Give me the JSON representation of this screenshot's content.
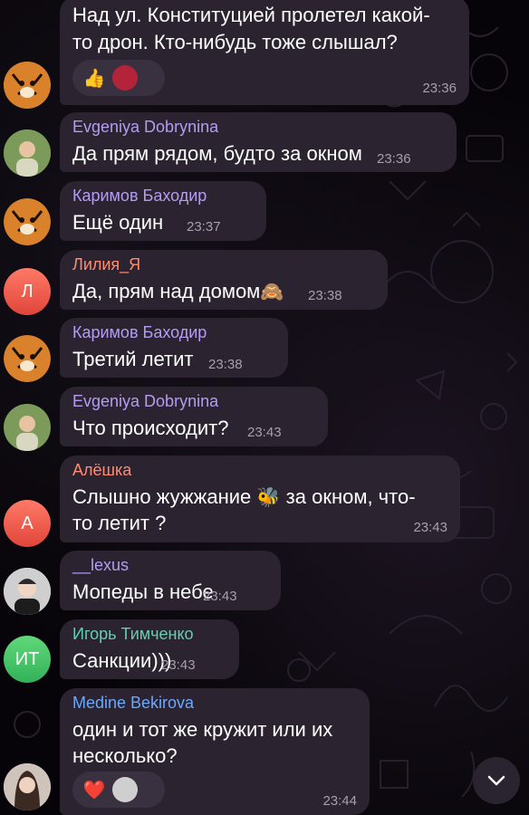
{
  "colors": {
    "bubble": "#2b2330",
    "time": "#a89fae",
    "name_purple": "#b49cf2",
    "name_orange": "#ff8c70",
    "name_green": "#62d0b0",
    "name_blue": "#6aa8ff"
  },
  "messages": [
    {
      "id": "m1",
      "lines": [
        "Над ул. Конституцией пролетел какой-",
        "то дрон. Кто-нибудь тоже слышал?"
      ],
      "time": "23:36",
      "reactions": [
        "👍",
        "avatar"
      ],
      "avatar": "tiger-avatar"
    },
    {
      "id": "m2",
      "sender": "Evgeniya Dobrynina",
      "lines": [
        "Да прям рядом, будто за окном"
      ],
      "time": "23:36",
      "avatar": "photo-avatar"
    },
    {
      "id": "m3",
      "sender": "Каримов Баходир",
      "lines": [
        "Ещё один"
      ],
      "time": "23:37",
      "avatar": "tiger-avatar"
    },
    {
      "id": "m4",
      "sender": "Лилия_Я",
      "lines": [
        "Да, прям над домом"
      ],
      "emoji": "🙈",
      "time": "23:38",
      "avatar_letter": "Л"
    },
    {
      "id": "m5",
      "sender": "Каримов Баходир",
      "lines": [
        "Третий летит"
      ],
      "time": "23:38",
      "avatar": "tiger-avatar"
    },
    {
      "id": "m6",
      "sender": "Evgeniya Dobrynina",
      "lines": [
        "Что происходит?"
      ],
      "time": "23:43",
      "avatar": "photo-avatar"
    },
    {
      "id": "m7",
      "sender": "Алёшка",
      "line1_before": "Слышно жужжание",
      "emoji": "🐝",
      "line1_after": "за окном, что-",
      "line2": "то летит ?",
      "time": "23:43",
      "avatar_letter": "А"
    },
    {
      "id": "m8",
      "sender": "__lexus",
      "lines": [
        "Мопеды в небе"
      ],
      "time": "23:43",
      "avatar": "photo-avatar-man"
    },
    {
      "id": "m9",
      "sender": "Игорь Тимченко",
      "lines": [
        "Санкции)))"
      ],
      "time": "23:43",
      "avatar_letter": "ИТ"
    },
    {
      "id": "m10",
      "sender": "Medine Bekirova",
      "lines": [
        "один и тот же кружит или их",
        "несколько?"
      ],
      "time": "23:44",
      "reactions": [
        "❤️",
        "avatar"
      ],
      "avatar": "photo-avatar-woman"
    }
  ],
  "scroll_button": {
    "icon": "chevron-down-icon"
  }
}
